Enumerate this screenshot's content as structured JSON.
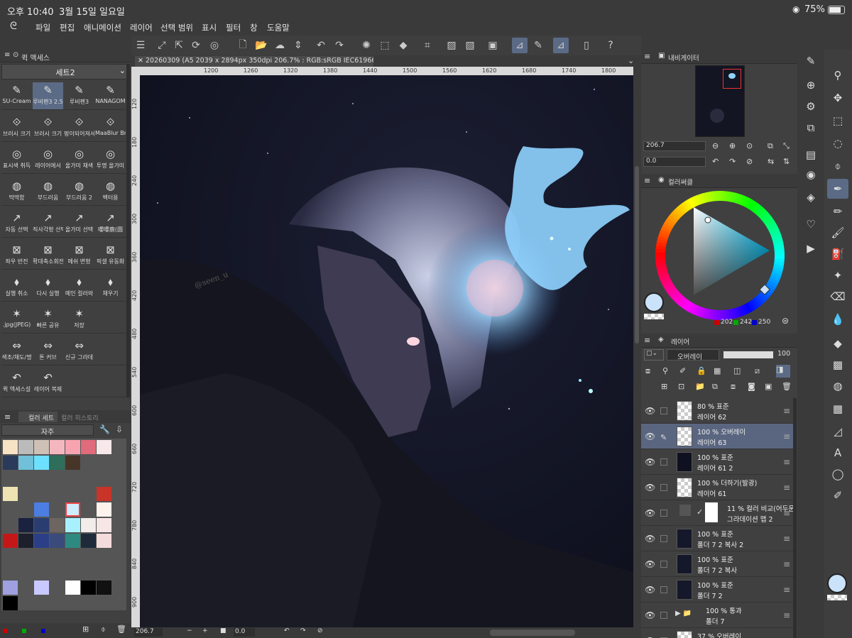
{
  "status": {
    "time": "오후 10:40",
    "date": "3월 15일 일요일",
    "battery": "75%"
  },
  "menu": [
    "파일",
    "편집",
    "애니메이션",
    "레이어",
    "선택 범위",
    "표시",
    "필터",
    "창",
    "도움말"
  ],
  "quick_access": {
    "panel_title": "퀵 액세스",
    "set_name": "세트2",
    "tools": [
      [
        "SU-Cream",
        "루비펜3 2.5",
        "루비펜3",
        "NANAGOM"
      ],
      [
        "브러시 크기",
        "브러시 크기",
        "펑이되어져서",
        "MaaBlur Bru"
      ],
      [
        "표시색 취득",
        "레이어에서",
        "올가미 채색",
        "투명 올가미"
      ],
      [
        "딱딱함",
        "부드러움",
        "부드러움 2",
        "벡터용"
      ],
      [
        "자동 선택",
        "직사각형 선택",
        "올가미 선택",
        "嚶嚶鹿(圆"
      ],
      [
        "좌우 반전",
        "확대축소회전",
        "메쉬 변형",
        "픽셀 유동화"
      ],
      [
        "실행 취소",
        "다시 실행",
        "메인 컬러와",
        "채우기"
      ],
      [
        ".jpg(JPEG)",
        "빠른 공유",
        "저장",
        ""
      ],
      [
        "색조/채도/명",
        "톤 커브",
        "신규 그라데",
        ""
      ],
      [
        "퀵 액세스설",
        "레이어 복제",
        "",
        ""
      ]
    ]
  },
  "color_set": {
    "tab1": "컬러 세트",
    "tab2": "컬러 히스토리",
    "set_name": "자주"
  },
  "document": {
    "tab": "20260309 (A5 2039 x 2894px 350dpi 206.7% : RGB:sRGB IEC61966-2.1)",
    "ruler_h": [
      "1200",
      "1260",
      "1320",
      "1380",
      "1440",
      "1500",
      "1560",
      "1620",
      "1680",
      "1740",
      "1800"
    ],
    "ruler_v": [
      "120",
      "180",
      "240",
      "300",
      "360",
      "420",
      "480",
      "540",
      "600",
      "660",
      "720",
      "780",
      "840",
      "900"
    ],
    "signature": "@seen_u"
  },
  "bottom": {
    "zoom": "206.7",
    "angle": "0.0"
  },
  "navigator": {
    "title": "내비게이터",
    "zoom": "206.7",
    "angle": "0.0"
  },
  "color_circle": {
    "title": "컬러써클",
    "r": "202",
    "g": "242",
    "b": "250",
    "main_color": "#cae2fa"
  },
  "layer_panel": {
    "title": "레이어",
    "blend": "오버레이",
    "opacity": "100",
    "layers": [
      {
        "mode": "80 % 표준",
        "name": "레이어 62",
        "selected": false
      },
      {
        "mode": "100 % 오버레이",
        "name": "레이어 63",
        "selected": true
      },
      {
        "mode": "100 % 표준",
        "name": "레이어 61 2",
        "selected": false
      },
      {
        "mode": "100 % 더하기(발광)",
        "name": "레이어 61",
        "selected": false
      },
      {
        "mode": "11 % 컬러 비교(어두운",
        "name": "그라데이션 맵 2",
        "selected": false
      },
      {
        "mode": "100 % 표준",
        "name": "폴더 7 2 복사 2",
        "selected": false
      },
      {
        "mode": "100 % 표준",
        "name": "폴더 7 2 복사",
        "selected": false
      },
      {
        "mode": "100 % 표준",
        "name": "폴더 7 2",
        "selected": false
      },
      {
        "mode": "100 % 통과",
        "name": "폴더 7",
        "selected": false
      },
      {
        "mode": "37 % 오버레이",
        "name": "",
        "selected": false
      }
    ]
  },
  "colors": {
    "accent": "#5b6b86",
    "panel": "#404040"
  }
}
